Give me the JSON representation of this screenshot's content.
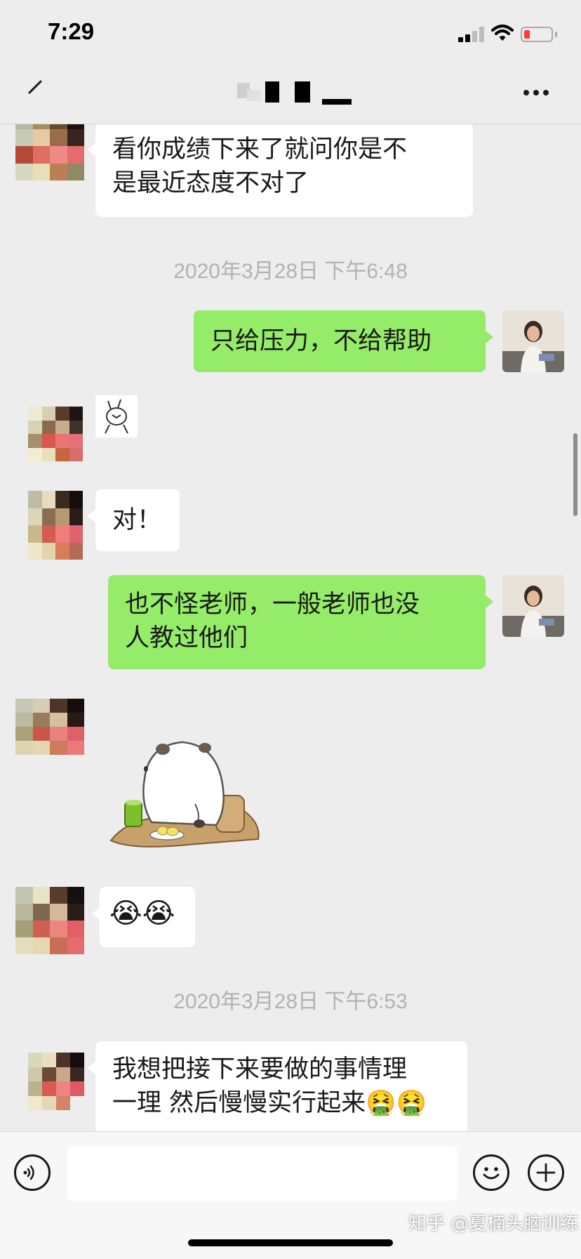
{
  "status_bar": {
    "time": "7:29"
  },
  "nav": {
    "title": ""
  },
  "messages": [
    {
      "side": "in",
      "text": "看你成绩下来了就问你是不是最近态度不对了"
    },
    {
      "type": "timestamp",
      "text": "2020年3月28日 下午6:48"
    },
    {
      "side": "out",
      "text": "只给压力，不给帮助"
    },
    {
      "side": "in",
      "type": "sticker",
      "sticker": "small-rabbit-sticker"
    },
    {
      "side": "in",
      "text": "对！"
    },
    {
      "side": "out",
      "text": "也不怪老师，一般老师也没人教过他们"
    },
    {
      "side": "in",
      "type": "sticker",
      "sticker": "panda-drinking-sticker"
    },
    {
      "side": "in",
      "type": "emoji",
      "emoji": "crying-face-emoji x2"
    },
    {
      "type": "timestamp",
      "text": "2020年3月28日 下午6:53"
    },
    {
      "side": "in",
      "text": "我想把接下来要做的事情理一理 然后慢慢实行起来"
    }
  ],
  "chat": {
    "msg1": "看你成绩下来了就问你是不\n是最近态度不对了",
    "ts1": "2020年3月28日 下午6:48",
    "msg2": "只给压力，不给帮助",
    "msg3": "对！",
    "msg4": "也不怪老师，一般老师也没\n人教过他们",
    "msg5_emoji": "😭😭",
    "ts2": "2020年3月28日 下午6:53",
    "msg6": "我想把接下来要做的事情理\n一理 然后慢慢实行起来🤮🤮"
  },
  "colors": {
    "out_bubble": "#95ec69",
    "in_bubble": "#ffffff",
    "background": "#ededed"
  },
  "watermark": "知乎 @夏楠头脑训练",
  "icons": [
    "back-icon",
    "more-icon",
    "voice-icon",
    "emoji-icon",
    "plus-icon"
  ]
}
